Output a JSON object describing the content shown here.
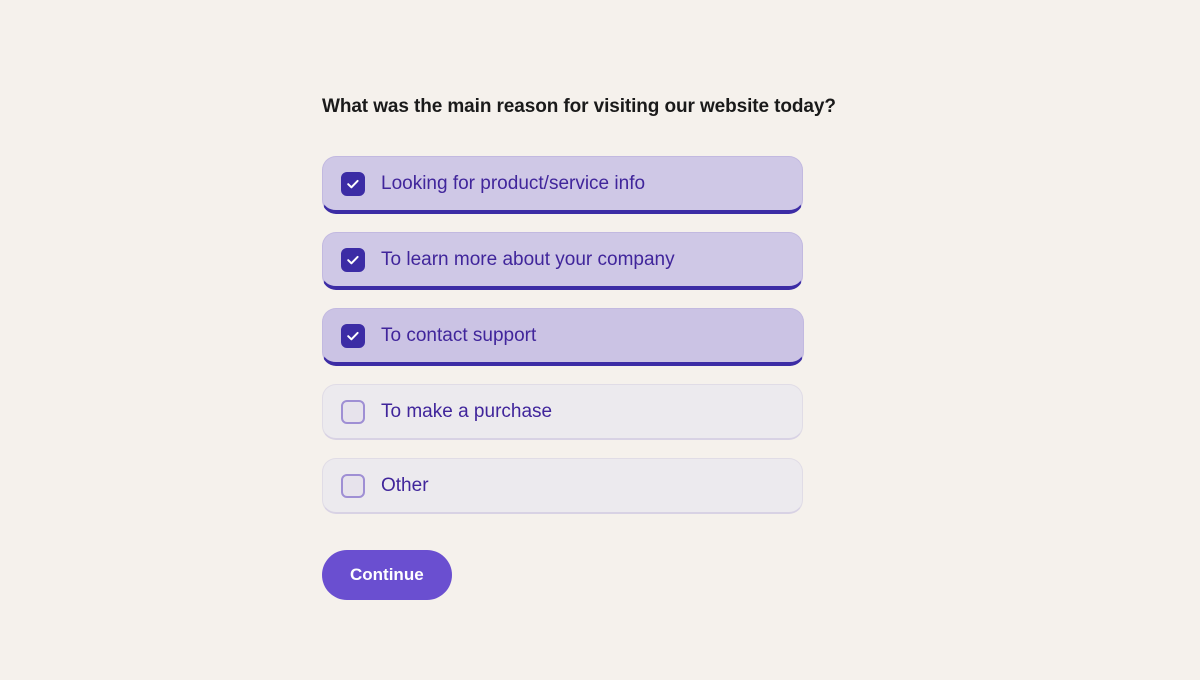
{
  "survey": {
    "question": "What was the main reason for visiting our website today?",
    "options": [
      {
        "label": "Looking for product/service info",
        "checked": true,
        "state": "selected"
      },
      {
        "label": "To learn more about your company",
        "checked": true,
        "state": "selected"
      },
      {
        "label": "To contact support",
        "checked": true,
        "state": "hovered"
      },
      {
        "label": "To make a purchase",
        "checked": false,
        "state": "unselected"
      },
      {
        "label": "Other",
        "checked": false,
        "state": "unselected"
      }
    ],
    "submit_label": "Continue"
  },
  "colors": {
    "page_background": "#f5f1ec",
    "selected_fill": "#cfc8e6",
    "selected_accent": "#3c2ca5",
    "unselected_fill": "#eceaee",
    "label_text": "#40259b",
    "title_text": "#1a1a1a",
    "button_fill": "#6a4fd0",
    "button_text": "#ffffff",
    "checkbox_checked_fill": "#3c2ca5",
    "checkbox_unchecked_border": "#9f8fd4"
  },
  "icons": {
    "check": "check-icon"
  }
}
